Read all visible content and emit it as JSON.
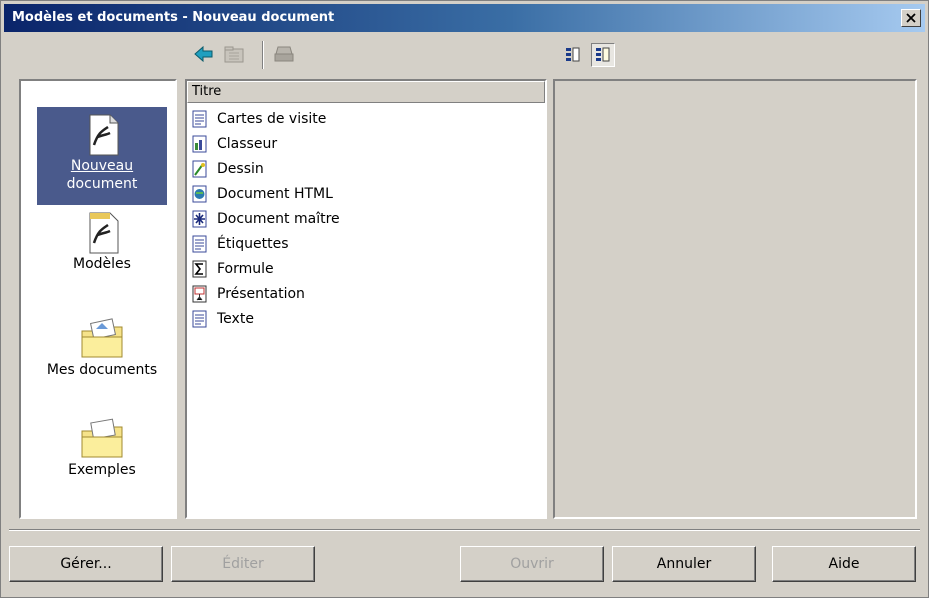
{
  "window": {
    "title": "Modèles et documents - Nouveau document"
  },
  "toolbar": {
    "icons": [
      "back-arrow-icon",
      "folder-up-icon",
      "print-icon",
      "detail-view-icon",
      "preview-view-icon"
    ]
  },
  "sidebar": {
    "items": [
      {
        "label_line1": "Nouveau",
        "label_line2": "document",
        "icon": "new-document-icon",
        "selected": true
      },
      {
        "label_line1": "Modèles",
        "label_line2": "",
        "icon": "templates-icon",
        "selected": false
      },
      {
        "label_line1": "Mes documents",
        "label_line2": "",
        "icon": "my-documents-folder-icon",
        "selected": false
      },
      {
        "label_line1": "Exemples",
        "label_line2": "",
        "icon": "examples-folder-icon",
        "selected": false
      }
    ]
  },
  "list": {
    "header": "Titre",
    "items": [
      {
        "label": "Cartes de visite",
        "icon": "writer-doc-icon"
      },
      {
        "label": "Classeur",
        "icon": "calc-doc-icon"
      },
      {
        "label": "Dessin",
        "icon": "draw-doc-icon"
      },
      {
        "label": "Document HTML",
        "icon": "html-doc-icon"
      },
      {
        "label": "Document maître",
        "icon": "master-doc-icon"
      },
      {
        "label": "Étiquettes",
        "icon": "writer-doc-icon"
      },
      {
        "label": "Formule",
        "icon": "math-doc-icon"
      },
      {
        "label": "Présentation",
        "icon": "impress-doc-icon"
      },
      {
        "label": "Texte",
        "icon": "writer-doc-icon"
      }
    ]
  },
  "buttons": {
    "manage": "Gérer...",
    "edit": "Éditer",
    "open": "Ouvrir",
    "cancel": "Annuler",
    "help": "Aide"
  },
  "colors": {
    "selection": "#4a5a8c",
    "titlebar": "#0a246a"
  }
}
